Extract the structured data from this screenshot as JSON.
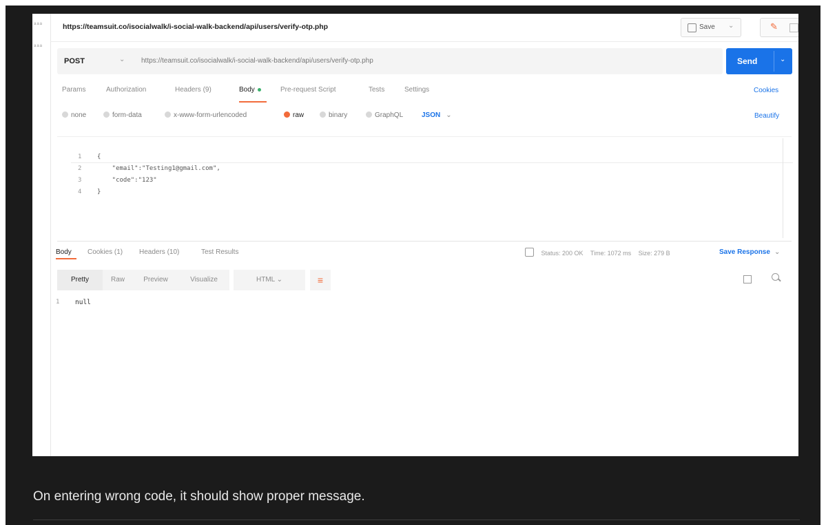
{
  "gutter": {
    "a": "aaa",
    "b": "aaa"
  },
  "tab_url": "https://teamsuit.co/isocialwalk/i-social-walk-backend/api/users/verify-otp.php",
  "toolbar": {
    "save_label": "Save"
  },
  "request": {
    "method": "POST",
    "url": "https://teamsuit.co/isocialwalk/i-social-walk-backend/api/users/verify-otp.php",
    "send_label": "Send"
  },
  "request_tabs": [
    "Params",
    "Authorization",
    "Headers (9)",
    "Body",
    "Pre-request Script",
    "Tests",
    "Settings"
  ],
  "cookies_label": "Cookies",
  "body_types": [
    "none",
    "form-data",
    "x-www-form-urlencoded",
    "raw",
    "binary",
    "GraphQL"
  ],
  "body_format": "JSON",
  "beautify_label": "Beautify",
  "editor": {
    "line_numbers": [
      "1",
      "2",
      "3",
      "4"
    ],
    "lines": [
      "{",
      "    \"email\":\"Testing1@gmail.com\",",
      "    \"code\":\"123\"",
      "}"
    ]
  },
  "response_tabs": [
    "Body",
    "Cookies (1)",
    "Headers (10)",
    "Test Results"
  ],
  "status": {
    "status": "Status: 200 OK",
    "time": "Time: 1072 ms",
    "size": "Size: 279 B"
  },
  "save_response_label": "Save Response",
  "view_modes": [
    "Pretty",
    "Raw",
    "Preview",
    "Visualize"
  ],
  "response_format": "HTML",
  "response": {
    "line_number": "1",
    "content": "null"
  },
  "caption": "On entering wrong code, it should show proper message.",
  "colors": {
    "accent": "#f26b3a",
    "primary": "#1a73e8",
    "background": "#1b1b1b"
  }
}
